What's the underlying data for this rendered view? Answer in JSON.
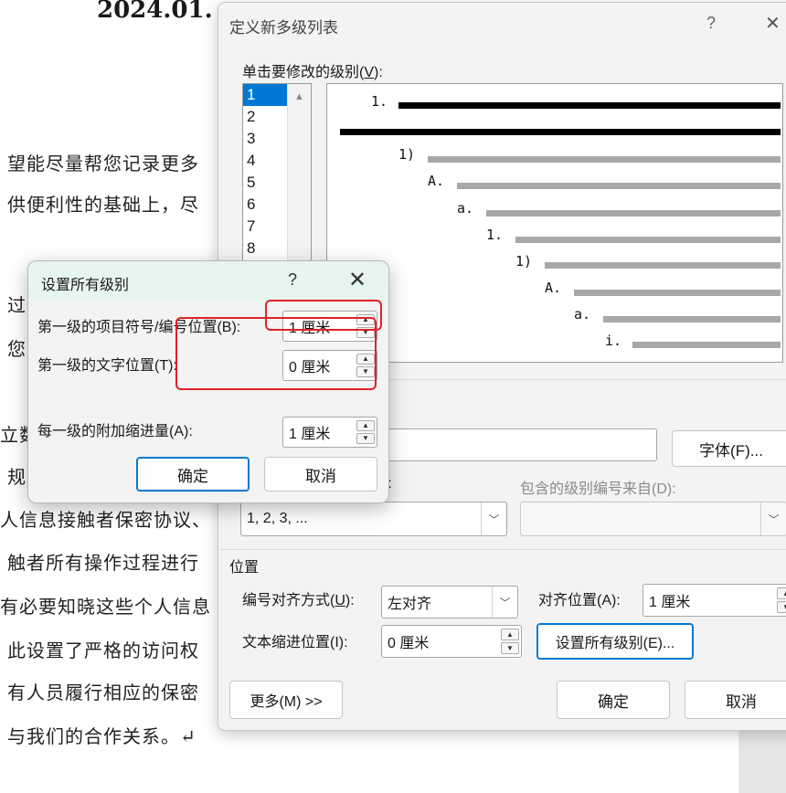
{
  "document": {
    "title": "2024.01.",
    "lines": [
      "望能尽量帮您记录更多",
      "供便利性的基础上，尽",
      "过",
      "您",
      "立数",
      "规",
      "人信息接触者保密协议、",
      "触者所有操作过程进行",
      "有必要知晓这些个人信息",
      "此设置了严格的访问权",
      "有人员履行相应的保密",
      "与我们的合作关系。↵"
    ]
  },
  "main_dialog": {
    "title": "定义新多级列表",
    "help": "?",
    "close": "✕",
    "level_label_pre": "单击要修改的级别(",
    "level_label_key": "V",
    "level_label_post": "):",
    "levels": [
      "1",
      "2",
      "3",
      "4",
      "5",
      "6",
      "7",
      "8"
    ],
    "preview_labels": [
      "1.",
      "1)",
      "A.",
      "a.",
      "1.",
      "1)",
      "A.",
      "a.",
      "i."
    ],
    "font_button": "字体(F)...",
    "number_style_value": "1, 2, 3, ...",
    "number_style_label_tail": "):",
    "include_level_label": "包含的级别编号来自(D):",
    "position_section": "位置",
    "align_label_pre": "编号对齐方式(",
    "align_label_key": "U",
    "align_label_post": "):",
    "align_value": "左对齐",
    "align_at_label": "对齐位置(A):",
    "align_at_value": "1 厘米",
    "text_indent_label": "文本缩进位置(I):",
    "text_indent_value": "0 厘米",
    "set_all_button": "设置所有级别(E)...",
    "more_button": "更多(M) >>",
    "ok_button": "确定",
    "cancel_button": "取消",
    "colors": {
      "selected": "#0078d4",
      "black_bar": "#000000",
      "gray_bar": "#a8a8a8"
    }
  },
  "set_all_dialog": {
    "title": "设置所有级别",
    "help": "?",
    "close": "✕",
    "first_bullet_label": "第一级的项目符号/编号位置(B):",
    "first_bullet_value": "1 厘米",
    "first_text_label": "第一级的文字位置(T):",
    "first_text_value": "0 厘米",
    "additional_indent_label": "每一级的附加缩进量(A):",
    "additional_indent_value": "1 厘米",
    "ok_button": "确定",
    "cancel_button": "取消",
    "header_color": "#e7f5ef"
  },
  "annotation": {
    "highlight_color": "#e0202a"
  }
}
